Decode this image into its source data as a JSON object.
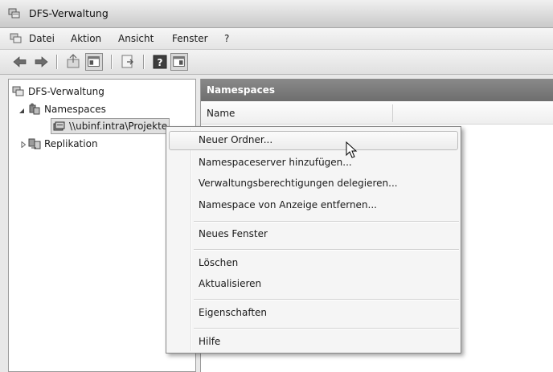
{
  "window": {
    "title": "DFS-Verwaltung"
  },
  "menubar": {
    "items": [
      "Datei",
      "Aktion",
      "Ansicht",
      "Fenster",
      "?"
    ]
  },
  "toolbar": {
    "buttons": [
      "back-arrow-icon",
      "forward-arrow-icon",
      "up-folder-icon",
      "show-hide-tree-icon",
      "export-list-icon",
      "help-icon",
      "console-icon"
    ]
  },
  "tree": {
    "root_label": "DFS-Verwaltung",
    "namespaces_label": "Namespaces",
    "namespace_item": "\\\\ubinf.intra\\Projekte",
    "replication_label": "Replikation"
  },
  "content": {
    "header": "Namespaces",
    "column_name": "Name"
  },
  "context_menu": {
    "items": [
      "Neuer Ordner...",
      "Namespaceserver hinzufügen...",
      "Verwaltungsberechtigungen delegieren...",
      "Namespace von Anzeige entfernen...",
      "Neues Fenster",
      "Löschen",
      "Aktualisieren",
      "Eigenschaften",
      "Hilfe"
    ]
  }
}
